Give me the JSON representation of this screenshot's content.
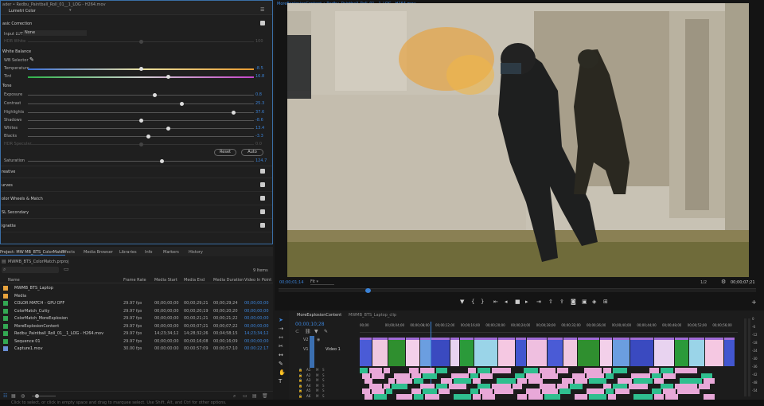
{
  "window": {
    "source_title": "ader • Redbu_Paintball_Roll_01__1_LOG - H264.mov",
    "program_title": "MoreExplosionContent • Redbu_Paintball_Roll_01__1_LOG - H264.mov"
  },
  "lumetri": {
    "title": "Lumetri Color",
    "basic_correction": "asic Correction",
    "input_lut_label": "Input LUT",
    "input_lut_value": "None",
    "hdr_white_label": "HDR White",
    "hdr_white_value": "100",
    "white_balance": "White Balance",
    "wb_selector": "WB Selector",
    "temperature_label": "Temperature",
    "temperature_value": "-8.5",
    "tint_label": "Tint",
    "tint_value": "16.8",
    "tone": "Tone",
    "exposure_label": "Exposure",
    "exposure_value": "0.8",
    "contrast_label": "Contrast",
    "contrast_value": "25.3",
    "highlights_label": "Highlights",
    "highlights_value": "37.6",
    "shadows_label": "Shadows",
    "shadows_value": "-8.6",
    "whites_label": "Whites",
    "whites_value": "13.4",
    "blacks_label": "Blacks",
    "blacks_value": "-3.3",
    "hdr_specular_label": "HDR Specular",
    "hdr_specular_value": "0.0",
    "reset_button": "Reset",
    "auto_button": "Auto",
    "saturation_label": "Saturation",
    "saturation_value": "124.7",
    "sections": [
      "reative",
      "urves",
      "olor Wheels & Match",
      "SL Secondary",
      "ignette"
    ],
    "sliders": {
      "hdr_white": 0.5,
      "temperature": 0.5,
      "tint": 0.62,
      "exposure": 0.56,
      "contrast": 0.68,
      "highlights": 0.91,
      "shadows": 0.5,
      "whites": 0.62,
      "blacks": 0.53,
      "hdr_specular": 0.5,
      "saturation": 0.59
    }
  },
  "project": {
    "tabs": [
      "Project: MW MB_BTS_ColorMatch",
      "Effects",
      "Media Browser",
      "Libraries",
      "Info",
      "Markers",
      "History"
    ],
    "file": "MWMB_BTS_ColorMatch.prproj",
    "items_count": "9 Items",
    "columns": [
      "Name",
      "Frame Rate",
      "Media Start",
      "Media End",
      "Media Duration",
      "Video In Point"
    ],
    "rows": [
      {
        "name": "MWMB_BTS_Laptop",
        "fps": "",
        "start": "",
        "end": "",
        "dur": "",
        "vin": "",
        "color": "#e8a33d"
      },
      {
        "name": "Media",
        "fps": "",
        "start": "",
        "end": "",
        "dur": "",
        "vin": "",
        "color": "#e8a33d"
      },
      {
        "name": "COLOR MATCH - GPU OFF",
        "fps": "29.97 fps",
        "start": "00;00;00;00",
        "end": "00;00;29;21",
        "dur": "00;00;29;24",
        "vin": "00;00;00;00",
        "color": "#33a853"
      },
      {
        "name": "ColorMatch_Cutty",
        "fps": "29.97 fps",
        "start": "00;00;00;00",
        "end": "00;00;20;19",
        "dur": "00;00;20;20",
        "vin": "00;00;00;00",
        "color": "#33a853"
      },
      {
        "name": "ColorMatch_MoreExplosion",
        "fps": "29.97 fps",
        "start": "00;00;00;00",
        "end": "00;00;21;21",
        "dur": "00;00;21;22",
        "vin": "00;00;00;00",
        "color": "#33a853"
      },
      {
        "name": "MoreExplosionContent",
        "fps": "29.97 fps",
        "start": "00;00;00;00",
        "end": "00;00;07;21",
        "dur": "00;00;07;22",
        "vin": "00;00;00;00",
        "color": "#33a853"
      },
      {
        "name": "Redbu_Paintball_Roll_01__1_LOG - H264.mov",
        "fps": "29.97 fps",
        "start": "14;23;34;12",
        "end": "14;28;32;26",
        "dur": "00;04;58;15",
        "vin": "14;23;34;12",
        "color": "#33a853"
      },
      {
        "name": "Sequence 01",
        "fps": "29.97 fps",
        "start": "00;00;00;00",
        "end": "00;00;16;08",
        "dur": "00;00;16;09",
        "vin": "00;00;00;00",
        "color": "#33a853"
      },
      {
        "name": "Capture1.mov",
        "fps": "30.00 fps",
        "start": "00:00:00:00",
        "end": "00:00:57:09",
        "dur": "00:00:57:10",
        "vin": "00:00:22:17",
        "color": "#6a8fd6"
      }
    ]
  },
  "program": {
    "timecode": "00;00;01;14",
    "fit": "Fit",
    "resolution": "1/2",
    "duration": "00;00;07;21"
  },
  "timeline": {
    "tabs": [
      "MoreExplosionContent",
      "MWMB_BTS_Laptop_clip"
    ],
    "timecode": "00;00;10;28",
    "ruler": [
      "00;00",
      "00;00;04;00",
      "00;00;08;00",
      "00;00;12;00",
      "00;00;16;00",
      "00;00;20;00",
      "00;00;24;00",
      "00;00;28;00",
      "00;00;32;00",
      "00;00;36;00",
      "00;00;40;00",
      "00;00;44;00",
      "00;00;48;00",
      "00;00;52;00",
      "00;00;56;00"
    ],
    "video_track": "Video 1",
    "track_labels": [
      "V2",
      "V1",
      "A1",
      "A2",
      "A3",
      "A4",
      "A5",
      "A6"
    ],
    "meter_labels": [
      "0",
      "-6",
      "-12",
      "-18",
      "-24",
      "-30",
      "-36",
      "-42",
      "-48",
      "-54"
    ]
  },
  "status": {
    "text": "Click to select, or click in empty space and drag to marquee select. Use Shift, Alt, and Ctrl for other options."
  }
}
